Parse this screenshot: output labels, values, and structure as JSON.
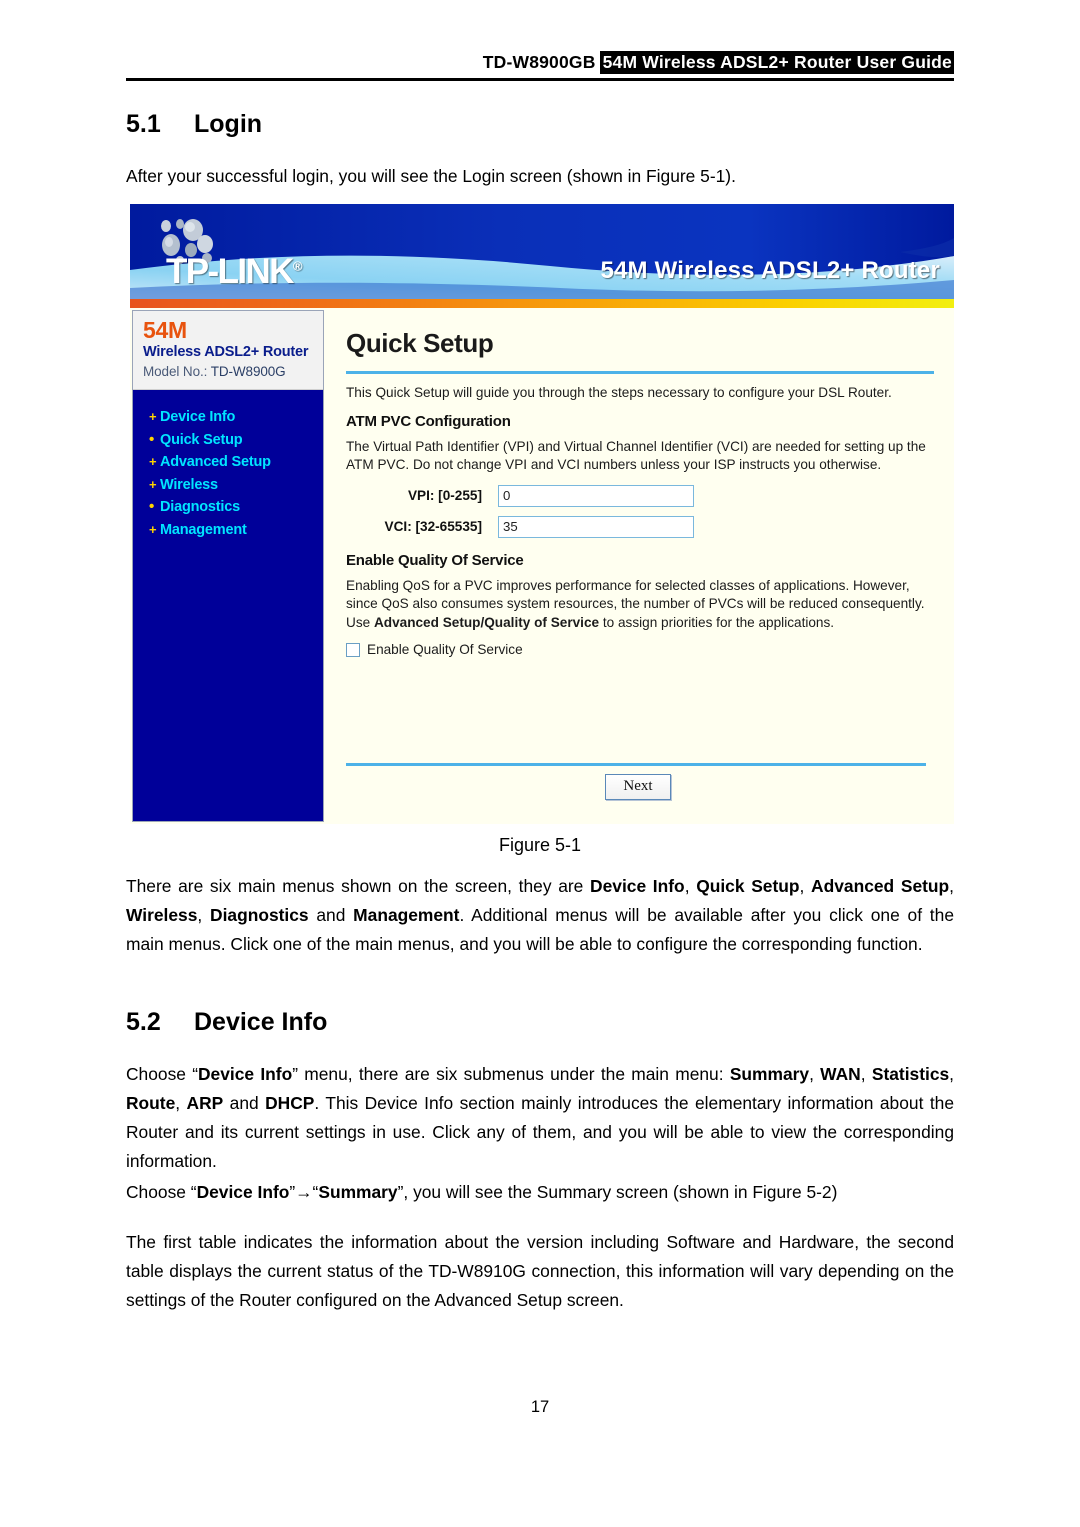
{
  "header": {
    "model": "TD-W8900GB",
    "highlight": "54M Wireless ADSL2+ Router User Guide"
  },
  "sections": {
    "s51_num": "5.1",
    "s51_title": "Login",
    "s51_intro": "After your successful login, you will see the Login screen (shown in Figure 5-1).",
    "s52_num": "5.2",
    "s52_title": "Device Info"
  },
  "figure": {
    "caption": "Figure 5-1",
    "banner": {
      "logo": "TP-LINK",
      "logo_reg": "®",
      "title": "54M Wireless ADSL2+ Router"
    },
    "sidebar": {
      "speed": "54M",
      "product": "Wireless ADSL2+ Router",
      "model_label": "Model No.:",
      "model_value": "TD-W8900G",
      "menu": [
        {
          "label": "Device Info",
          "marker": "+"
        },
        {
          "label": "Quick Setup",
          "marker": "•"
        },
        {
          "label": "Advanced Setup",
          "marker": "+"
        },
        {
          "label": "Wireless",
          "marker": "+"
        },
        {
          "label": "Diagnostics",
          "marker": "•"
        },
        {
          "label": "Management",
          "marker": "+"
        }
      ]
    },
    "main": {
      "title": "Quick Setup",
      "intro": "This Quick Setup will guide you through the steps necessary to configure your DSL Router.",
      "atm_heading": "ATM PVC Configuration",
      "atm_text": "The Virtual Path Identifier (VPI) and Virtual Channel Identifier (VCI) are needed for setting up the ATM PVC. Do not change VPI and VCI numbers unless your ISP instructs you otherwise.",
      "vpi_label": "VPI: [0-255]",
      "vpi_value": "0",
      "vci_label": "VCI: [32-65535]",
      "vci_value": "35",
      "qos_heading": "Enable Quality Of Service",
      "qos_text_1": "Enabling QoS for a PVC improves performance for selected classes of applications. However, since QoS also consumes system resources, the number of PVCs will be reduced consequently. Use ",
      "qos_text_bold": "Advanced Setup/Quality of Service",
      "qos_text_2": " to assign priorities for the applications.",
      "qos_checkbox_label": "Enable Quality Of Service",
      "qos_checked": false,
      "next_label": "Next"
    }
  },
  "body": {
    "p_menus_1": "There are six main menus shown on the screen, they are ",
    "p_menus_b1": "Device Info",
    "p_menus_2": ", ",
    "p_menus_b2": "Quick Setup",
    "p_menus_3": ", ",
    "p_menus_b3": "Advanced Setup",
    "p_menus_4": ", ",
    "p_menus_b4": "Wireless",
    "p_menus_5": ", ",
    "p_menus_b5": "Diagnostics",
    "p_menus_6": " and ",
    "p_menus_b6": "Management",
    "p_menus_7": ". Additional menus will be available after you click one of the main menus. Click one of the main menus, and you will be able to configure the corresponding function.",
    "p_devinfo_1": "Choose “",
    "p_devinfo_b1": "Device Info",
    "p_devinfo_2": "” menu, there are six submenus under the main menu: ",
    "p_devinfo_b2": "Summary",
    "p_devinfo_3": ", ",
    "p_devinfo_b3": "WAN",
    "p_devinfo_4": ", ",
    "p_devinfo_b4": "Statistics",
    "p_devinfo_5": ", ",
    "p_devinfo_b5": "Route",
    "p_devinfo_6": ", ",
    "p_devinfo_b6": "ARP",
    "p_devinfo_7": " and ",
    "p_devinfo_b7": "DHCP",
    "p_devinfo_8": ". This Device Info section mainly introduces the elementary information about the Router and its current settings in use. Click any of them, and you will be able to view the corresponding information.",
    "p_summary_1": "Choose “",
    "p_summary_b1": "Device Info",
    "p_summary_2": "”→“",
    "p_summary_b2": "Summary",
    "p_summary_3": "”, you will see the Summary screen (shown in Figure 5-2)",
    "p_tables": "The first table indicates the information about the version including Software and Hardware, the second table displays the current status of the TD-W8910G connection, this information will vary depending on the settings of the Router configured on the Advanced Setup screen."
  },
  "page_number": "17",
  "colors": {
    "banner_blue": "#00188f",
    "swoosh_light": "#9fe0f5",
    "sidebar_navy": "#000099",
    "menu_cyan": "#00e5ff",
    "marker_yellow": "#ffd400",
    "accent_orange": "#e8530e",
    "rule_blue": "#4db2e8",
    "panel_cream": "#fffff0"
  }
}
